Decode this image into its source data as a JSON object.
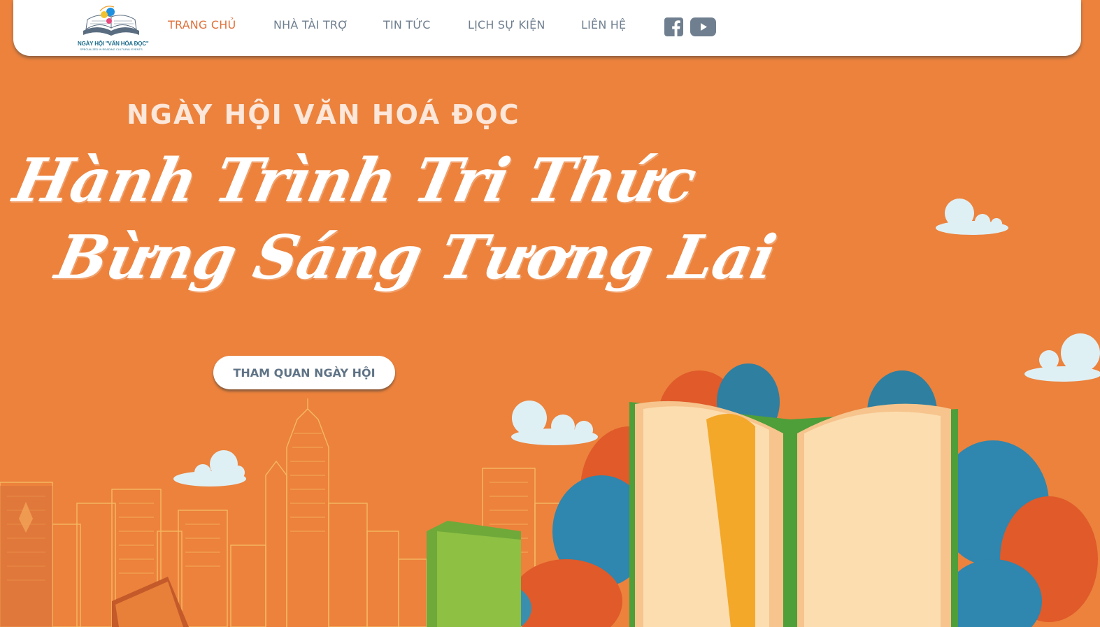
{
  "logo": {
    "title": "NGÀY HỘI \"VĂN HÓA ĐỌC\"",
    "subtitle": "SPECIALIZED IN READING CULTURAL EVENTS"
  },
  "nav": {
    "items": [
      {
        "label": "TRANG CHỦ",
        "active": true
      },
      {
        "label": "NHÀ TÀI TRỢ",
        "active": false
      },
      {
        "label": "TIN TỨC",
        "active": false
      },
      {
        "label": "LỊCH SỰ KIỆN",
        "active": false
      },
      {
        "label": "LIÊN HỆ",
        "active": false
      }
    ],
    "social": [
      "facebook-icon",
      "youtube-icon"
    ]
  },
  "hero": {
    "kicker": "NGÀY HỘI VĂN HOÁ ĐỌC",
    "line1": "Hành Trình Tri Thức",
    "line2": "Bừng Sáng Tương Lai",
    "cta_label": "THAM QUAN NGÀY HỘI"
  },
  "colors": {
    "background": "#EC823C",
    "nav_active": "#E0703A",
    "nav_text": "#6F7F8F",
    "cta_text": "#5F7386"
  }
}
